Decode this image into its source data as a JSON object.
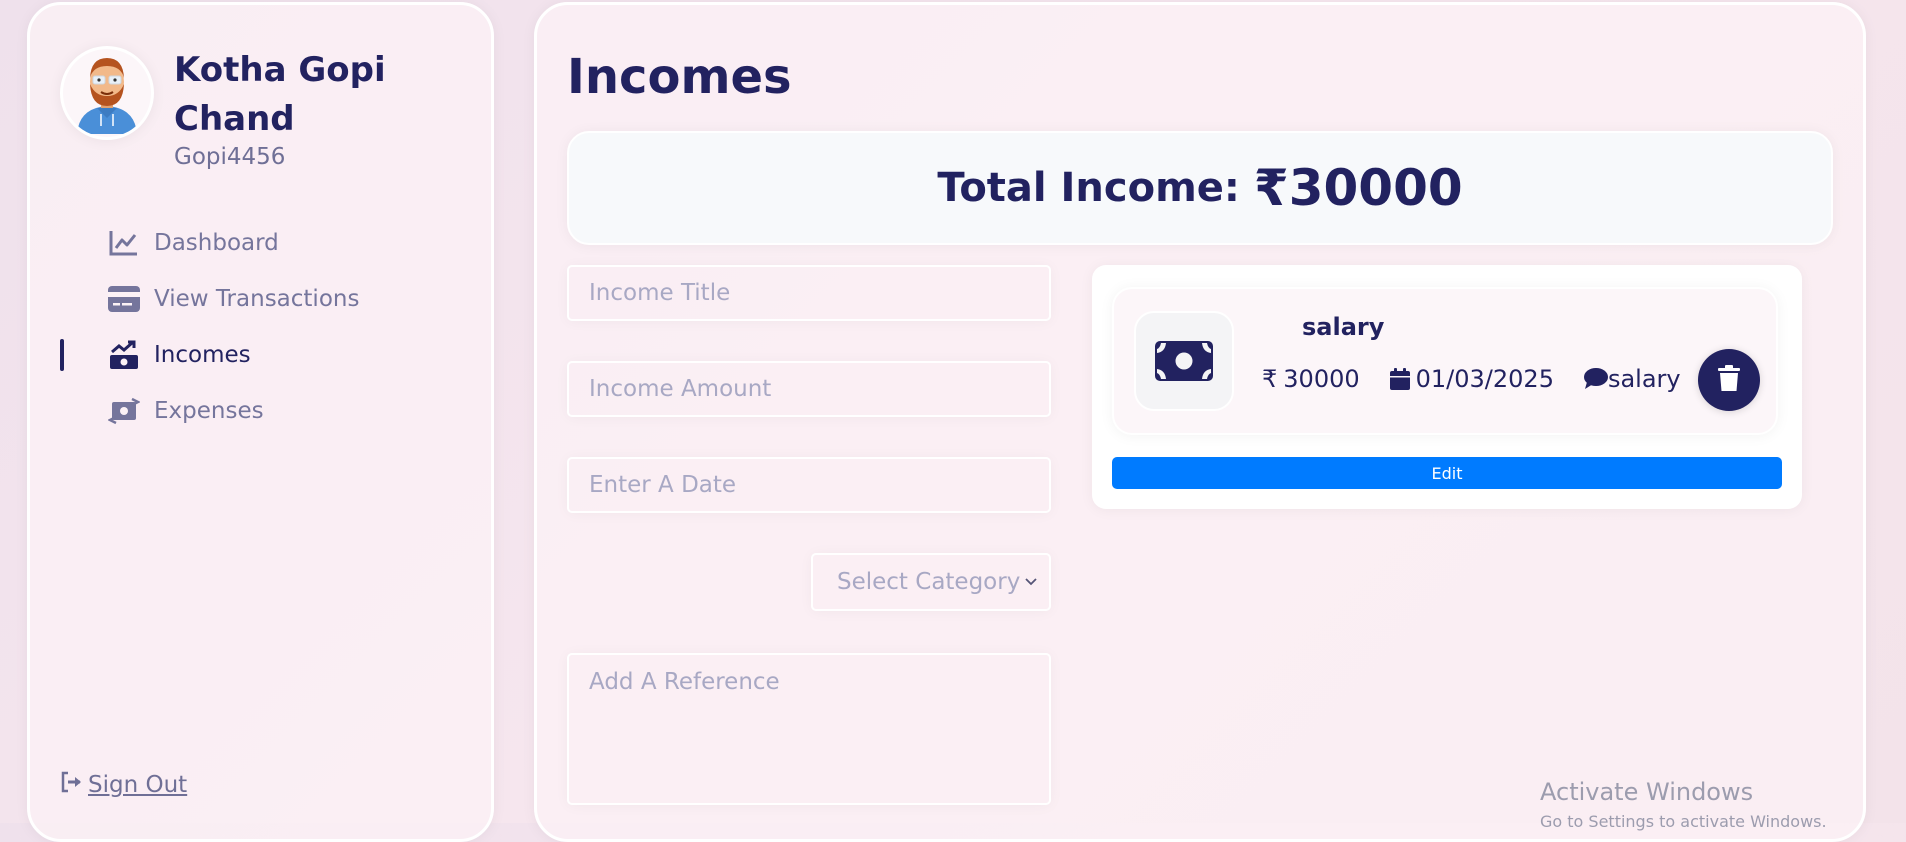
{
  "profile": {
    "name": "Kotha Gopi Chand",
    "handle": "Gopi4456"
  },
  "nav": {
    "items": [
      {
        "label": "Dashboard",
        "icon": "chart-line-icon"
      },
      {
        "label": "View Transactions",
        "icon": "credit-card-icon"
      },
      {
        "label": "Incomes",
        "icon": "money-trend-icon",
        "active": true
      },
      {
        "label": "Expenses",
        "icon": "money-exchange-icon"
      }
    ],
    "sign_out": "Sign Out"
  },
  "page": {
    "title": "Incomes",
    "total_label": "Total Income:",
    "total_value": "₹30000"
  },
  "form": {
    "title_placeholder": "Income Title",
    "amount_placeholder": "Income Amount",
    "date_placeholder": "Enter A Date",
    "category_selected": "Select Category",
    "reference_placeholder": "Add A Reference"
  },
  "income_items": [
    {
      "title": "salary",
      "amount": "30000",
      "date": "01/03/2025",
      "description": "salary",
      "icon": "money-bill-icon"
    }
  ],
  "buttons": {
    "edit": "Edit"
  },
  "watermark": {
    "title": "Activate Windows",
    "subtitle": "Go to Settings to activate Windows."
  },
  "colors": {
    "primary": "#222260",
    "muted": "#75759c",
    "edit_button": "#007bff",
    "placeholder": "#a8a8c4"
  }
}
